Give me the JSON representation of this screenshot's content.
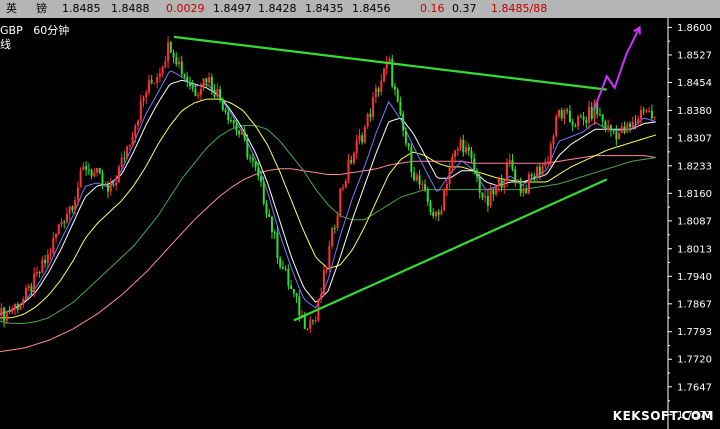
{
  "header": {
    "name_chars": [
      "英",
      "镑"
    ],
    "fields": [
      {
        "value": "1.8485",
        "color": "#000000"
      },
      {
        "value": "1.8488",
        "color": "#000000"
      },
      {
        "value": "0.0029",
        "color": "#c00000"
      },
      {
        "value": "1.8497",
        "color": "#000000"
      },
      {
        "value": "1.8428",
        "color": "#000000"
      },
      {
        "value": "1.8435",
        "color": "#000000"
      },
      {
        "value": "1.8456",
        "color": "#000000"
      },
      {
        "value": "0.16",
        "color": "#c00000"
      },
      {
        "value": "0.37",
        "color": "#000000"
      },
      {
        "value": "1.8485/88",
        "color": "#c00000"
      }
    ]
  },
  "corner": {
    "symbol": "GBP",
    "period": "60分钟",
    "line2": "线"
  },
  "watermark": "KEKSOFT.COM",
  "chart_data": {
    "type": "line",
    "symbol": "GBP",
    "period": "60分钟",
    "ylim": [
      1.7535,
      1.8625
    ],
    "y_ticks": [
      "1.8600",
      "1.8527",
      "1.8454",
      "1.8380",
      "1.8307",
      "1.8233",
      "1.8160",
      "1.8087",
      "1.8013",
      "1.7940",
      "1.7867",
      "1.7793",
      "1.7720",
      "1.7647",
      "1.7573"
    ],
    "price_path": [
      1.7835,
      1.7855,
      1.788,
      1.7935,
      1.7995,
      1.8085,
      1.814,
      1.8235,
      1.8205,
      1.8155,
      1.824,
      1.8335,
      1.843,
      1.848,
      1.856,
      1.8485,
      1.843,
      1.847,
      1.842,
      1.836,
      1.83,
      1.822,
      1.812,
      1.7985,
      1.79,
      1.782,
      1.7825,
      1.799,
      1.816,
      1.826,
      1.833,
      1.843,
      1.851,
      1.8345,
      1.822,
      1.815,
      1.8085,
      1.823,
      1.83,
      1.8225,
      1.8125,
      1.818,
      1.824,
      1.8165,
      1.821,
      1.8245,
      1.8375,
      1.835,
      1.835,
      1.8385,
      1.833,
      1.832,
      1.8335,
      1.839,
      1.835
    ],
    "ma_fast": [
      1.784,
      1.785,
      1.787,
      1.79,
      1.795,
      1.801,
      1.808,
      1.815,
      1.818,
      1.8185,
      1.821,
      1.827,
      1.834,
      1.84,
      1.845,
      1.846,
      1.845,
      1.844,
      1.842,
      1.838,
      1.833,
      1.827,
      1.819,
      1.809,
      1.799,
      1.791,
      1.787,
      1.79,
      1.799,
      1.809,
      1.818,
      1.827,
      1.835,
      1.836,
      1.832,
      1.826,
      1.82,
      1.82,
      1.822,
      1.822,
      1.819,
      1.818,
      1.819,
      1.819,
      1.82,
      1.821,
      1.826,
      1.829,
      1.831,
      1.833,
      1.833,
      1.833,
      1.833,
      1.8345,
      1.835
    ],
    "ma_mid": [
      1.783,
      1.783,
      1.784,
      1.786,
      1.789,
      1.793,
      1.798,
      1.804,
      1.808,
      1.811,
      1.814,
      1.818,
      1.823,
      1.829,
      1.834,
      1.838,
      1.84,
      1.841,
      1.841,
      1.84,
      1.838,
      1.834,
      1.829,
      1.822,
      1.814,
      1.806,
      1.799,
      1.796,
      1.797,
      1.801,
      1.807,
      1.814,
      1.821,
      1.825,
      1.827,
      1.826,
      1.824,
      1.823,
      1.823,
      1.822,
      1.821,
      1.82,
      1.8195,
      1.819,
      1.819,
      1.819,
      1.821,
      1.823,
      1.8245,
      1.826,
      1.8275,
      1.8285,
      1.8295,
      1.8305,
      1.8315
    ],
    "ma_slow": [
      1.782,
      1.7815,
      1.7815,
      1.782,
      1.783,
      1.785,
      1.787,
      1.79,
      1.793,
      1.796,
      1.799,
      1.802,
      1.806,
      1.81,
      1.815,
      1.82,
      1.824,
      1.828,
      1.831,
      1.833,
      1.834,
      1.834,
      1.833,
      1.83,
      1.826,
      1.822,
      1.817,
      1.813,
      1.81,
      1.809,
      1.809,
      1.811,
      1.813,
      1.815,
      1.816,
      1.817,
      1.817,
      1.817,
      1.817,
      1.817,
      1.817,
      1.817,
      1.817,
      1.817,
      1.8175,
      1.818,
      1.8185,
      1.8195,
      1.8205,
      1.8215,
      1.8225,
      1.8235,
      1.8245,
      1.825,
      1.8255
    ],
    "ma_long": [
      1.774,
      1.7745,
      1.775,
      1.776,
      1.777,
      1.7785,
      1.78,
      1.782,
      1.784,
      1.7865,
      1.789,
      1.792,
      1.795,
      1.7985,
      1.802,
      1.8055,
      1.809,
      1.812,
      1.815,
      1.8175,
      1.8195,
      1.821,
      1.822,
      1.8225,
      1.8225,
      1.822,
      1.8215,
      1.821,
      1.821,
      1.8215,
      1.822,
      1.8225,
      1.8235,
      1.824,
      1.8245,
      1.8245,
      1.8245,
      1.8245,
      1.8245,
      1.824,
      1.824,
      1.824,
      1.824,
      1.824,
      1.824,
      1.824,
      1.8245,
      1.825,
      1.8255,
      1.826,
      1.826,
      1.826,
      1.826,
      1.826,
      1.8255
    ],
    "trendlines": [
      {
        "role": "upper",
        "color": "#33dd33",
        "from": [
          0.265,
          1.8575
        ],
        "to": [
          0.925,
          1.8435
        ]
      },
      {
        "role": "lower",
        "color": "#33dd33",
        "from": [
          0.448,
          1.7823
        ],
        "to": [
          0.925,
          1.8197
        ]
      }
    ],
    "arrow": {
      "color": "#cc33ff",
      "path": [
        [
          0.905,
          1.838
        ],
        [
          0.925,
          1.847
        ],
        [
          0.937,
          1.844
        ],
        [
          0.955,
          1.853
        ],
        [
          0.975,
          1.86
        ]
      ]
    },
    "colors": {
      "up": "#ff3333",
      "down": "#33dd33",
      "ma_fast": "#ffffff",
      "ma_mid": "#7777ff",
      "ma_slow": "#ffff55",
      "ma_long": "#ff8899",
      "ma_other": "#44aa44",
      "axis": "#ffffff"
    }
  }
}
